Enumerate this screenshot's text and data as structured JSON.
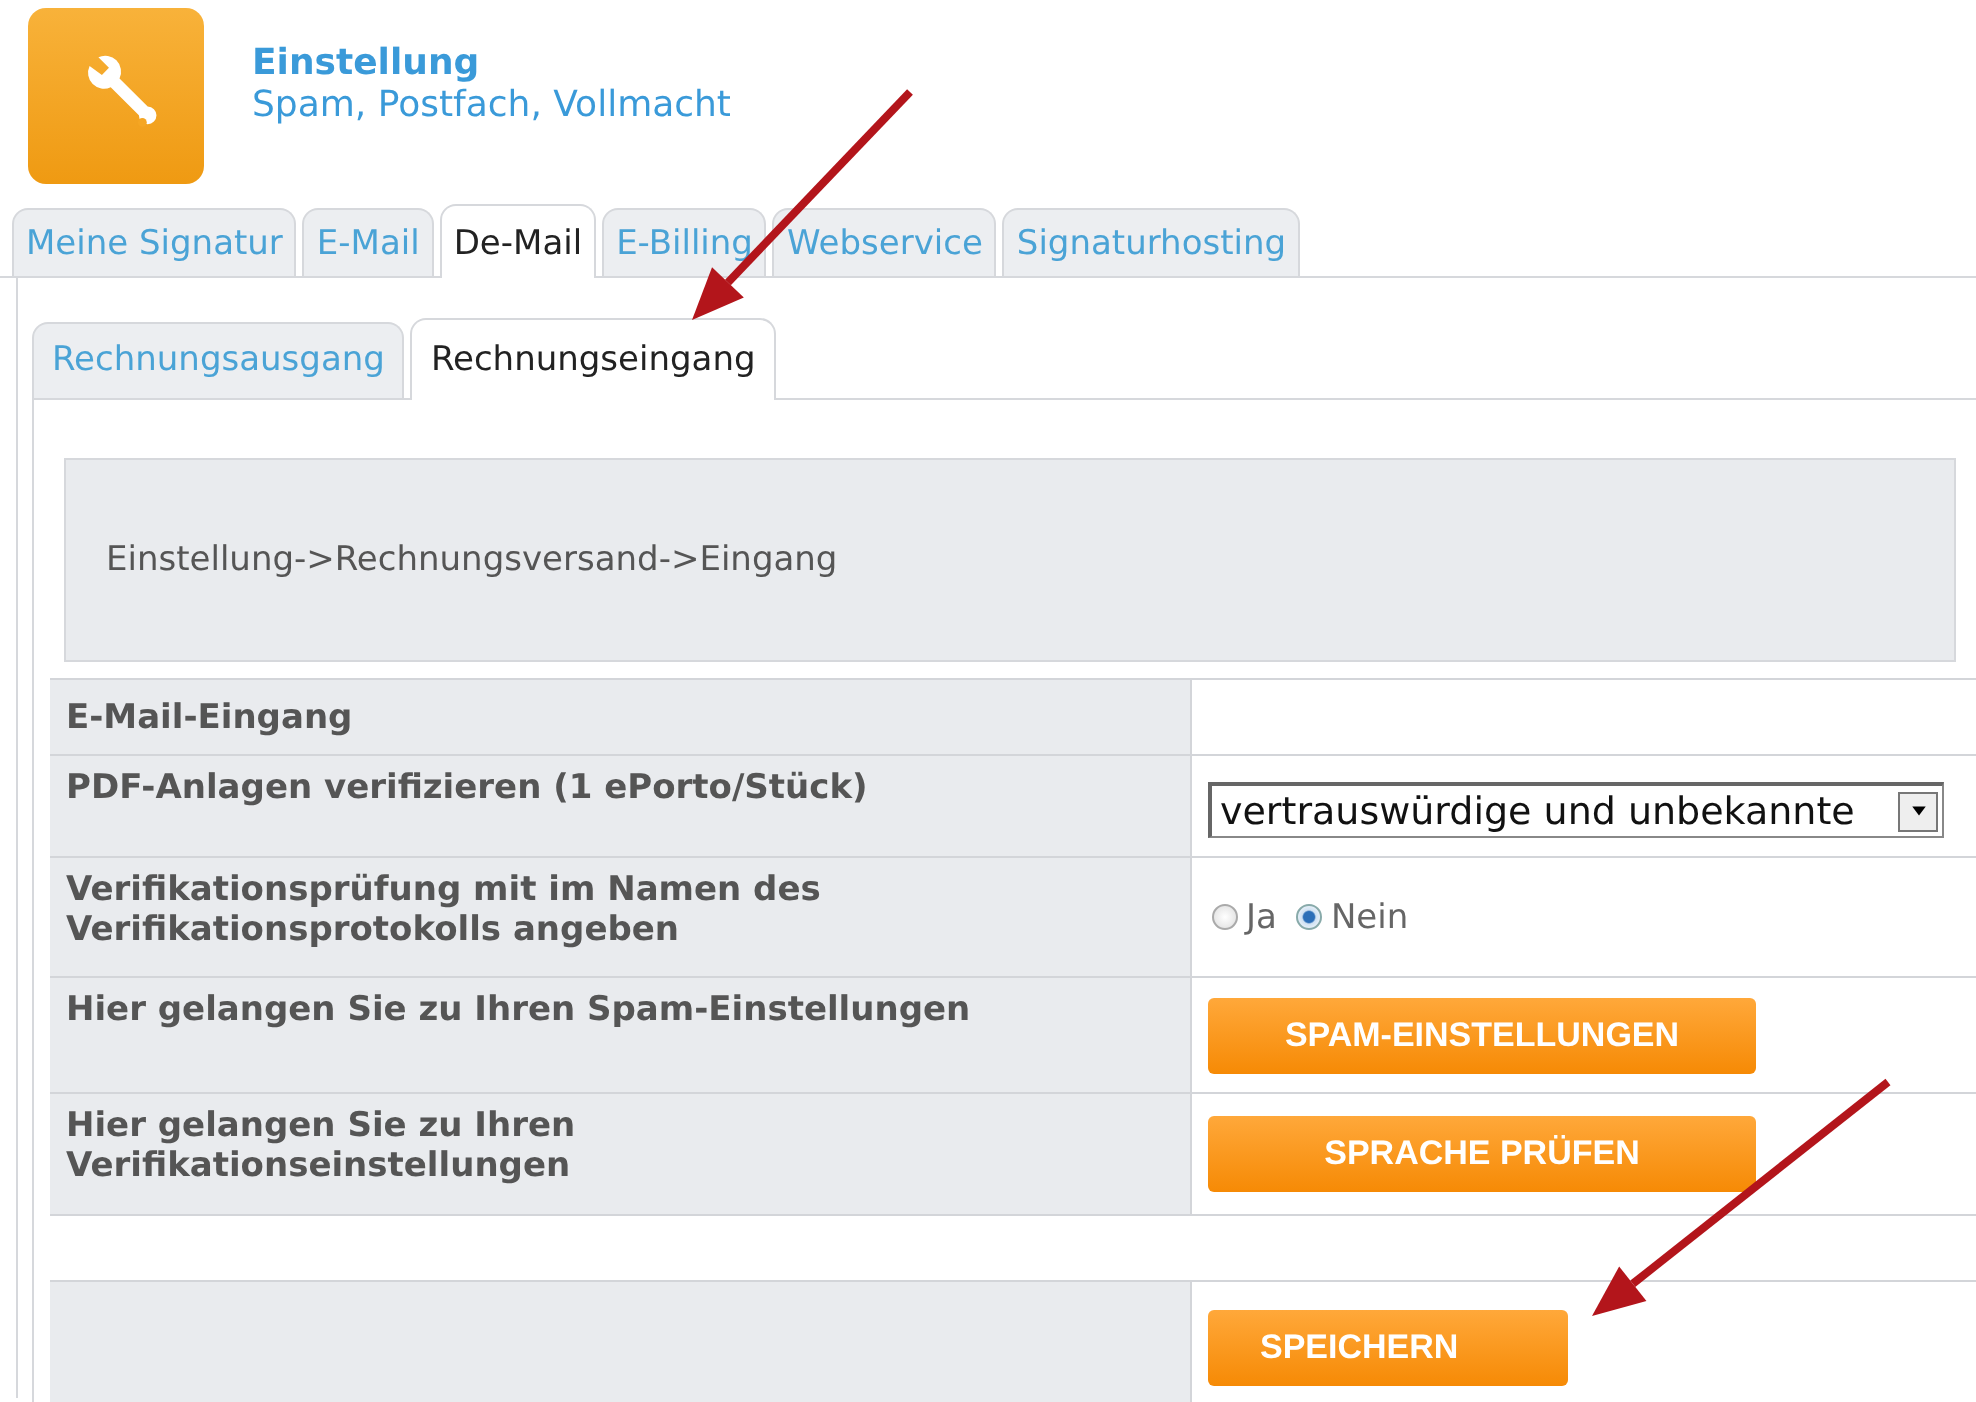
{
  "header": {
    "title": "Einstellung",
    "subtitle": "Spam, Postfach, Vollmacht"
  },
  "tabs": [
    {
      "label": "Meine Signatur",
      "selected": false
    },
    {
      "label": "E-Mail",
      "selected": false
    },
    {
      "label": "De-Mail",
      "selected": true
    },
    {
      "label": "E-Billing",
      "selected": false
    },
    {
      "label": "Webservice",
      "selected": false
    },
    {
      "label": "Signaturhosting",
      "selected": false
    }
  ],
  "subtabs": [
    {
      "label": "Rechnungsausgang",
      "selected": false
    },
    {
      "label": "Rechnungseingang",
      "selected": true
    }
  ],
  "breadcrumb": "Einstellung->Rechnungsversand->Eingang",
  "rows": [
    {
      "kind": "heading",
      "label": "E-Mail-Eingang"
    },
    {
      "kind": "select",
      "label": "PDF-Anlagen verifizieren (1 ePorto/Stück)",
      "value": "vertrauswürdige und unbekannte"
    },
    {
      "kind": "radio",
      "label": "Verifikationsprüfung mit im Namen des Verifikationsprotokolls angeben",
      "options": [
        {
          "label": "Ja",
          "selected": false
        },
        {
          "label": "Nein",
          "selected": true
        }
      ]
    },
    {
      "kind": "button",
      "label": "Hier gelangen Sie zu Ihren Spam-Einstellungen",
      "button": "SPAM-EINSTELLUNGEN"
    },
    {
      "kind": "button",
      "label": "Hier gelangen Sie zu Ihren Verifikationseinstellungen",
      "button": "SPRACHE PRÜFEN"
    },
    {
      "kind": "spacer"
    },
    {
      "kind": "save",
      "button": "SPEICHERN"
    }
  ]
}
